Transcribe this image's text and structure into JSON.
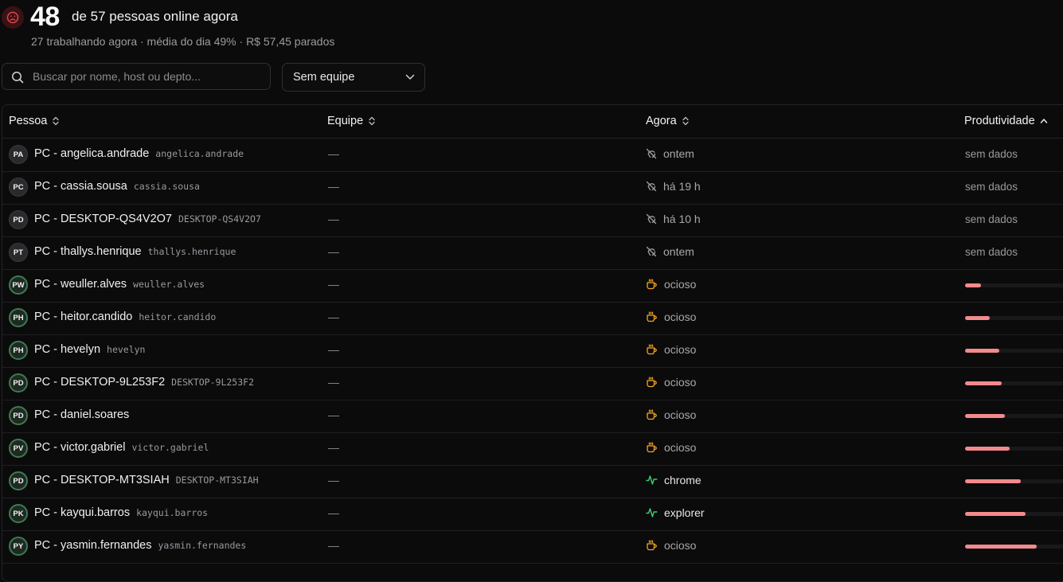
{
  "header": {
    "online_count": "48",
    "headline": "de 57 pessoas online agora",
    "subline": "27 trabalhando agora · média do dia 49% · R$ 57,45 parados",
    "mood_icon": "sad-face-icon",
    "mood_color": "#e0454b"
  },
  "search": {
    "placeholder": "Buscar por nome, host ou depto..."
  },
  "team_filter": {
    "selected": "Sem equipe"
  },
  "columns": {
    "person": "Pessoa",
    "team": "Equipe",
    "now": "Agora",
    "productivity": "Produtividade"
  },
  "colors": {
    "bar": "#f38a8c",
    "idle": "#f5a623",
    "active": "#3ecf6e"
  },
  "rows": [
    {
      "initials": "PA",
      "name": "PC - angelica.andrade",
      "host": "angelica.andrade",
      "team": "—",
      "status": "ontem",
      "status_icon": "offline-icon",
      "productivity_label": "sem dados",
      "productivity": null,
      "online": false
    },
    {
      "initials": "PC",
      "name": "PC - cassia.sousa",
      "host": "cassia.sousa",
      "team": "—",
      "status": "há 19 h",
      "status_icon": "offline-icon",
      "productivity_label": "sem dados",
      "productivity": null,
      "online": false
    },
    {
      "initials": "PD",
      "name": "PC - DESKTOP-QS4V2O7",
      "host": "DESKTOP-QS4V2O7",
      "team": "—",
      "status": "há 10 h",
      "status_icon": "offline-icon",
      "productivity_label": "sem dados",
      "productivity": null,
      "online": false
    },
    {
      "initials": "PT",
      "name": "PC - thallys.henrique",
      "host": "thallys.henrique",
      "team": "—",
      "status": "ontem",
      "status_icon": "offline-icon",
      "productivity_label": "sem dados",
      "productivity": null,
      "online": false
    },
    {
      "initials": "PW",
      "name": "PC - weuller.alves",
      "host": "weuller.alves",
      "team": "—",
      "status": "ocioso",
      "status_icon": "coffee-icon",
      "productivity_label": "",
      "productivity": 0.14,
      "online": true
    },
    {
      "initials": "PH",
      "name": "PC - heitor.candido",
      "host": "heitor.candido",
      "team": "—",
      "status": "ocioso",
      "status_icon": "coffee-icon",
      "productivity_label": "",
      "productivity": 0.22,
      "online": true
    },
    {
      "initials": "PH",
      "name": "PC - hevelyn",
      "host": "hevelyn",
      "team": "—",
      "status": "ocioso",
      "status_icon": "coffee-icon",
      "productivity_label": "",
      "productivity": 0.31,
      "online": true
    },
    {
      "initials": "PD",
      "name": "PC - DESKTOP-9L253F2",
      "host": "DESKTOP-9L253F2",
      "team": "—",
      "status": "ocioso",
      "status_icon": "coffee-icon",
      "productivity_label": "",
      "productivity": 0.33,
      "online": true
    },
    {
      "initials": "PD",
      "name": "PC - daniel.soares",
      "host": "",
      "team": "—",
      "status": "ocioso",
      "status_icon": "coffee-icon",
      "productivity_label": "",
      "productivity": 0.36,
      "online": true
    },
    {
      "initials": "PV",
      "name": "PC - victor.gabriel",
      "host": "victor.gabriel",
      "team": "—",
      "status": "ocioso",
      "status_icon": "coffee-icon",
      "productivity_label": "",
      "productivity": 0.4,
      "online": true
    },
    {
      "initials": "PD",
      "name": "PC - DESKTOP-MT3SIAH",
      "host": "DESKTOP-MT3SIAH",
      "team": "—",
      "status": "chrome",
      "status_icon": "activity-icon",
      "productivity_label": "",
      "productivity": 0.5,
      "online": true
    },
    {
      "initials": "PK",
      "name": "PC - kayqui.barros",
      "host": "kayqui.barros",
      "team": "—",
      "status": "explorer",
      "status_icon": "activity-icon",
      "productivity_label": "",
      "productivity": 0.54,
      "online": true
    },
    {
      "initials": "PY",
      "name": "PC - yasmin.fernandes",
      "host": "yasmin.fernandes",
      "team": "—",
      "status": "ocioso",
      "status_icon": "coffee-icon",
      "productivity_label": "",
      "productivity": 0.64,
      "online": true
    }
  ]
}
